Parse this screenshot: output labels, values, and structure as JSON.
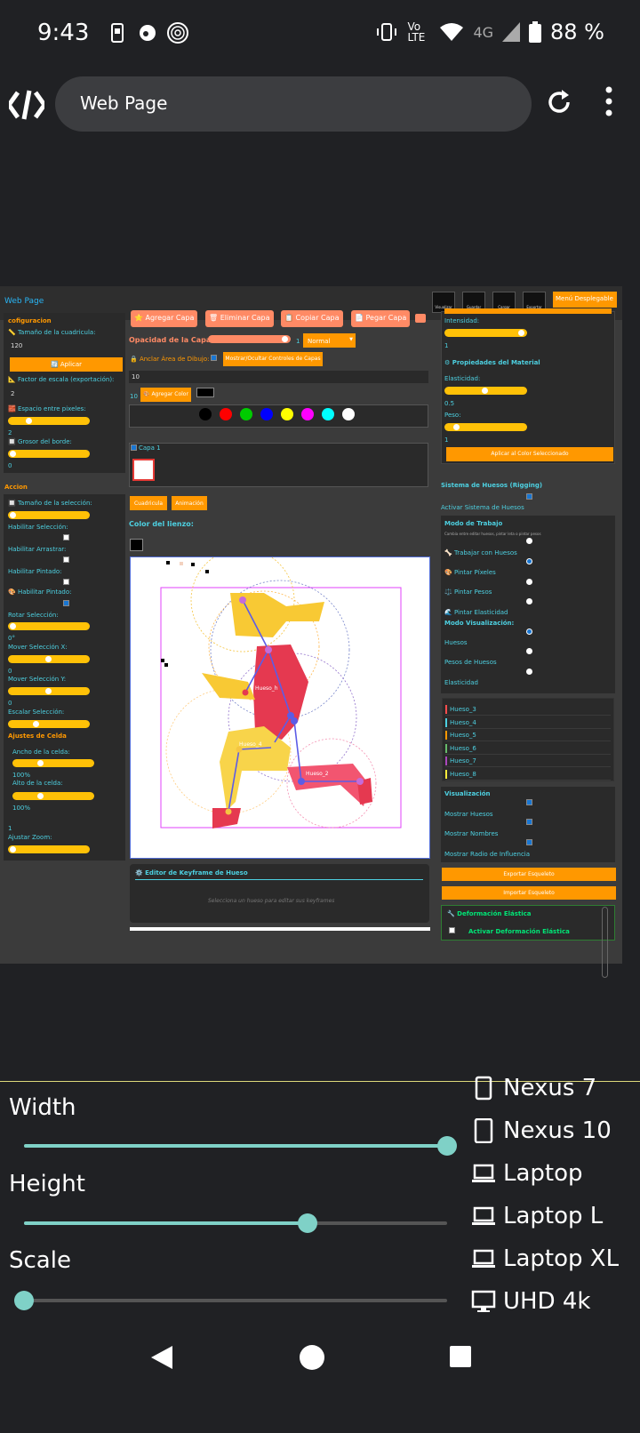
{
  "status": {
    "time": "9:43",
    "network": "Vo LTE",
    "signal": "4G",
    "battery": "88 %"
  },
  "browser": {
    "url_title": "Web Page"
  },
  "page": {
    "title": "Web Page",
    "header_buttons": [
      "Visualizar",
      "Guardar Proyecto",
      "Cargar Proyecto",
      "Exportar"
    ],
    "menu_button": "Menú Desplegable",
    "left": {
      "config_heading": "cofiguracion",
      "grid_size_label": "📏 Tamaño de la cuadricula:",
      "grid_size_value": "120",
      "apply_button": "🔄 Aplicar",
      "scale_label": "📐 Factor de escala (exportación):",
      "scale_value": "2",
      "pixel_space_label": "🧱 Espacio entre pixeles:",
      "pixel_space_value": "2",
      "border_label": "🔲 Grosor del borde:",
      "border_value": "0",
      "action_heading": "Accion",
      "selection_size_label": "🔲 Tamaño de la selección:",
      "enable_selection": "Habilitar Selección:",
      "enable_drag": "Habilitar Arrastrar:",
      "enable_paint": "Habilitar Pintado:",
      "enable_paint2": "🎨 Habilitar Pintado:",
      "rotate_label": "Rotar Selección:",
      "rotate_value": "0°",
      "move_x_label": "Mover Selección X:",
      "move_x_value": "0",
      "move_y_label": "Mover Selección Y:",
      "move_y_value": "0",
      "scale_sel_label": "Escalar Selección:",
      "cell_heading": "Ajustes de Celda",
      "cell_width_label": "Ancho de la celda:",
      "cell_width_value": "100%",
      "cell_height_label": "Alto de la celda:",
      "cell_height_value": "100%",
      "zoom_value": "1",
      "zoom_label": "Ajustar Zoom:"
    },
    "center": {
      "add_layer": "⭐ Agregar Capa",
      "delete_layer": "🗑 Eliminar Capa",
      "copy_layer": "📋 Copiar Capa",
      "paste_layer": "📄 Pegar Capa",
      "opacity_label": "Opacidad de la Capa:",
      "opacity_value": "1",
      "blend_mode": "Normal",
      "anchor_label": "🔒 Anclar Área de Dibujo:",
      "toggle_layers": "Mostrar/Ocultar Controles de Capas",
      "size_value": "10",
      "color_count": "10",
      "add_color": "🎨 Agregar Color",
      "palette": [
        "#000000",
        "#ff0000",
        "#00cc00",
        "#0000ff",
        "#ffff00",
        "#ff00ff",
        "#00ffff",
        "#ffffff"
      ],
      "layer_name": "Capa 1",
      "grid_button": "Cuadricula",
      "anim_button": "Animación",
      "canvas_color_label": "Color del lienzo:",
      "bone_labels": [
        "Hueso_h",
        "Hueso_4",
        "Hueso_2"
      ],
      "kf_title": "⚙️ Editor de Keyframe de Hueso",
      "kf_hint": "Selecciona un hueso para editar sus keyframes"
    },
    "right": {
      "intensity_label": "Intensidad:",
      "intensity_value": "1",
      "material_heading": "⚙ Propiedades del Material",
      "elasticity_label": "Elasticidad:",
      "elasticity_value": "0.5",
      "weight_label": "Peso:",
      "weight_value": "1",
      "apply_color": "Aplicar al Color Seleccionado",
      "rigging_heading": "Sistema de Huesos (Rigging)",
      "enable_rigging": "Activar Sistema de Huesos",
      "work_mode_heading": "Modo de Trabajo",
      "work_mode_hint": "Cambia entre editar huesos, pintar leta o pintar pesos",
      "mode_bones": "🦴 Trabajar con Huesos",
      "mode_pixels": "🎨 Pintar Píxeles",
      "mode_weights": "⚖️ Pintar Pesos",
      "mode_elastic": "🌊 Pintar Elasticidad",
      "vis_mode_heading": "Modo Visualización:",
      "vis_bones": "Huesos",
      "vis_weights": "Pesos de Huesos",
      "vis_elastic": "Elasticidad",
      "bones": [
        "Hueso_3",
        "Hueso_4",
        "Hueso_5",
        "Hueso_6",
        "Hueso_7",
        "Hueso_8"
      ],
      "bone_colors": [
        "#ff4d4d",
        "#4dd0e1",
        "#ff9800",
        "#66bb6a",
        "#ab47bc",
        "#ffeb3b"
      ],
      "visual_heading": "Visualización",
      "show_bones": "Mostrar Huesos",
      "show_names": "Mostrar Nombres",
      "show_radius": "Mostrar Radio de Influencia",
      "export_skeleton": "Exportar Esqueleto",
      "import_skeleton": "Importar Esqueleto",
      "deform_heading": "🔧 Deformación Elástica",
      "enable_deform": "Activar Deformación Elástica"
    }
  },
  "device_toolbar": {
    "width_label": "Width",
    "height_label": "Height",
    "scale_label": "Scale",
    "width_level": 1.0,
    "height_level": 0.67,
    "scale_level": 0.0,
    "presets": [
      "Nexus 7",
      "Nexus 10",
      "Laptop",
      "Laptop L",
      "Laptop XL",
      "UHD 4k"
    ]
  },
  "colors": {
    "accent_orange": "#ff9800",
    "accent_cyan": "#4dd0e1",
    "slider_teal": "#7fd1c7"
  }
}
